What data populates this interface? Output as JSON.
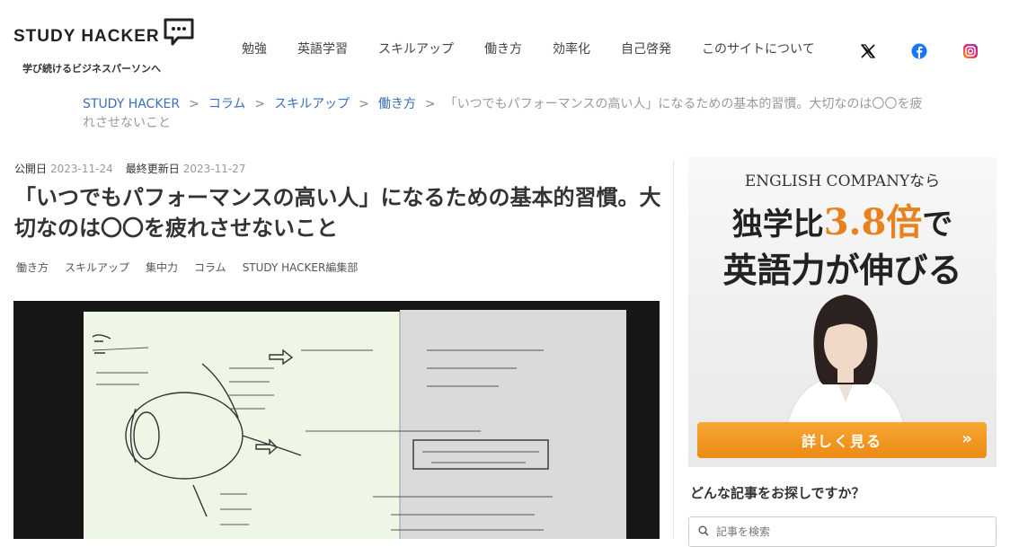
{
  "header": {
    "logo_text": "STUDY HACKER",
    "tagline": "学び続けるビジネスパーソンへ",
    "nav": [
      "勉強",
      "英語学習",
      "スキルアップ",
      "働き方",
      "効率化",
      "自己啓発",
      "このサイトについて"
    ],
    "social": [
      "x-icon",
      "facebook-icon",
      "instagram-icon"
    ],
    "colors": {
      "facebook": "#1877f2",
      "instagram": "#e1306c",
      "link": "#3b6fb6"
    }
  },
  "breadcrumb": {
    "items": [
      "STUDY HACKER",
      "コラム",
      "スキルアップ",
      "働き方"
    ],
    "separator": ">",
    "current": "「いつでもパフォーマンスの高い人」になるための基本的習慣。大切なのは〇〇を疲れさせないこと"
  },
  "article": {
    "published_label": "公開日",
    "published_date": "2023-11-24",
    "updated_label": "最終更新日",
    "updated_date": "2023-11-27",
    "title": "「いつでもパフォーマンスの高い人」になるための基本的習慣。大切なのは〇〇を疲れさせないこと",
    "tags": [
      "働き方",
      "スキルアップ",
      "集中力",
      "コラム",
      "STUDY HACKER編集部"
    ]
  },
  "sidebar": {
    "ad": {
      "line1": "ENGLISH COMPANYなら",
      "line2_pre": "独学比",
      "line2_highlight": "3.8倍",
      "line2_post": "で",
      "line3": "英語力が伸びる",
      "button": "詳しく見る",
      "button_chevron": "»",
      "accent": "#ec8a14"
    },
    "search": {
      "heading": "どんな記事をお探しですか？",
      "placeholder": "記事を検索"
    }
  }
}
